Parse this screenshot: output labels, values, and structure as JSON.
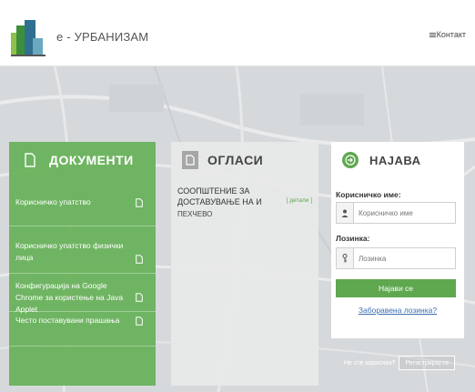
{
  "header": {
    "app_title": "е - УРБАНИЗАМ",
    "contact_label": "Контакт",
    "logo_icon": "city-buildings-logo-icon",
    "menu_icon": "hamburger-menu-icon"
  },
  "documents": {
    "title": "ДОКУМЕНТИ",
    "header_icon": "document-icon",
    "items": [
      {
        "label": "Корисничко упатство",
        "icon": "file-icon"
      },
      {
        "label": "Корисничко упатство физички лица",
        "icon": "file-icon"
      },
      {
        "label": "Конфигурација на Google Chrome за користење на Java Applet",
        "icon": "file-icon"
      },
      {
        "label": "Често поставувани прашања",
        "icon": "file-icon"
      }
    ]
  },
  "announcements": {
    "title": "ОГЛАСИ",
    "header_icon": "document-icon",
    "items": [
      {
        "title": "СООПШТЕНИЕ ЗА ДОСТАВУВАЊЕ НА И",
        "details_label": "[ детали ]",
        "description": "ПЕХЧЕВО"
      }
    ]
  },
  "login": {
    "title": "НАЈАВА",
    "header_icon": "sign-in-icon",
    "username_label": "Корисничко име:",
    "username_placeholder": "Корисничко име",
    "username_icon": "user-icon",
    "password_label": "Лозинка:",
    "password_placeholder": "Лозинка",
    "password_icon": "key-icon",
    "submit_label": "Најави се",
    "forgot_label": "Заборавена лозинка?"
  },
  "register": {
    "prompt": "Не сте корисник?",
    "button_label": "Регистрирај се"
  },
  "colors": {
    "green_accent": "#5fa850",
    "docs_panel": "#67b058",
    "ads_panel": "#e8e8e8",
    "link_blue": "#3b6fb0"
  }
}
